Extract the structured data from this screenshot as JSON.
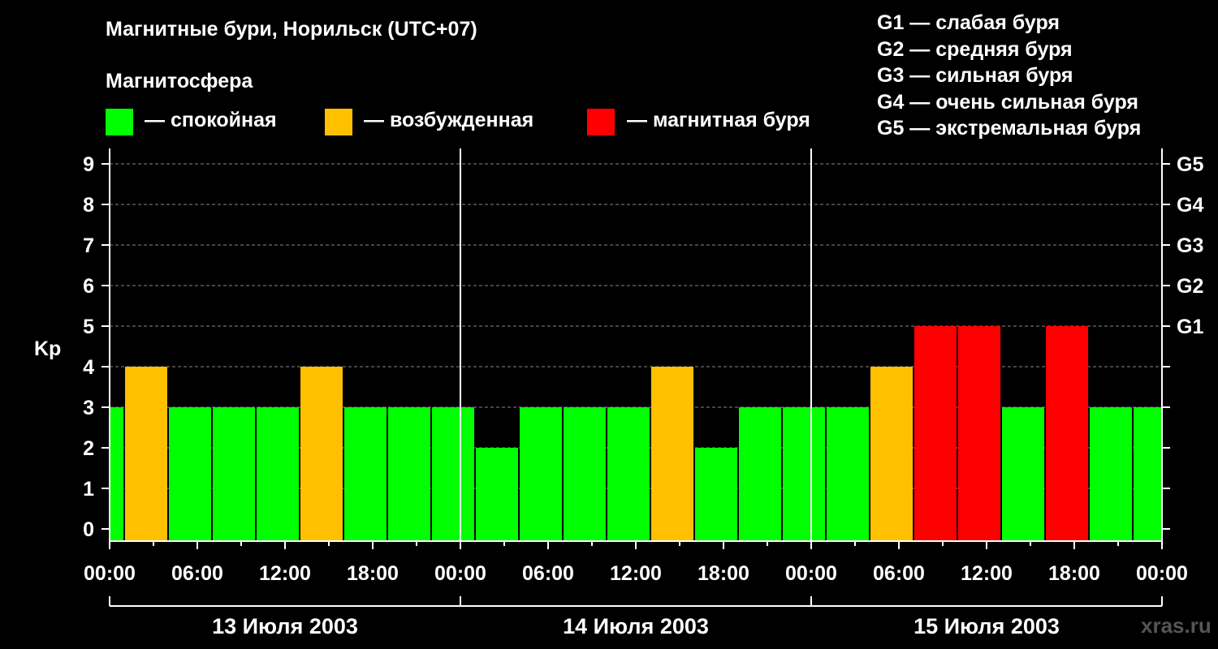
{
  "header": {
    "title": "Магнитные бури, Норильск (UTC+07)",
    "subtitle": "Магнитосфера"
  },
  "legend": [
    {
      "color": "#00ff00",
      "label": "— спокойная"
    },
    {
      "color": "#ffc000",
      "label": "— возбужденная"
    },
    {
      "color": "#ff0000",
      "label": "— магнитная буря"
    }
  ],
  "g_scale": [
    "G1 — слабая буря",
    "G2 — средняя буря",
    "G3 — сильная буря",
    "G4 — очень сильная буря",
    "G5 — экстремальная буря"
  ],
  "watermark": "xras.ru",
  "chart_data": {
    "type": "bar",
    "title": "Магнитные бури, Норильск (UTC+07)",
    "ylabel": "Kp",
    "ylim": [
      0,
      9
    ],
    "yticks": [
      "0",
      "1",
      "2",
      "3",
      "4",
      "5",
      "6",
      "7",
      "8",
      "9"
    ],
    "right_axis_labels": [
      {
        "kp": 5,
        "label": "G1"
      },
      {
        "kp": 6,
        "label": "G2"
      },
      {
        "kp": 7,
        "label": "G3"
      },
      {
        "kp": 8,
        "label": "G4"
      },
      {
        "kp": 9,
        "label": "G5"
      }
    ],
    "xlim_hours": [
      0,
      72
    ],
    "xticks": [
      "00:00",
      "06:00",
      "12:00",
      "18:00",
      "00:00",
      "06:00",
      "12:00",
      "18:00",
      "00:00",
      "06:00",
      "12:00",
      "18:00",
      "00:00"
    ],
    "dates": [
      "13 Июля 2003",
      "14 Июля 2003",
      "15 Июля 2003"
    ],
    "grid": "horizontal dashed",
    "colors": {
      "quiet": "#00ff00",
      "active": "#ffc000",
      "storm": "#ff0000"
    },
    "bars": [
      {
        "start_h": 0,
        "end_h": 1,
        "kp": 3,
        "state": "quiet"
      },
      {
        "start_h": 1,
        "end_h": 4,
        "kp": 4,
        "state": "active"
      },
      {
        "start_h": 4,
        "end_h": 7,
        "kp": 3,
        "state": "quiet"
      },
      {
        "start_h": 7,
        "end_h": 10,
        "kp": 3,
        "state": "quiet"
      },
      {
        "start_h": 10,
        "end_h": 13,
        "kp": 3,
        "state": "quiet"
      },
      {
        "start_h": 13,
        "end_h": 16,
        "kp": 4,
        "state": "active"
      },
      {
        "start_h": 16,
        "end_h": 19,
        "kp": 3,
        "state": "quiet"
      },
      {
        "start_h": 19,
        "end_h": 22,
        "kp": 3,
        "state": "quiet"
      },
      {
        "start_h": 22,
        "end_h": 25,
        "kp": 3,
        "state": "quiet"
      },
      {
        "start_h": 25,
        "end_h": 28,
        "kp": 2,
        "state": "quiet"
      },
      {
        "start_h": 28,
        "end_h": 31,
        "kp": 3,
        "state": "quiet"
      },
      {
        "start_h": 31,
        "end_h": 34,
        "kp": 3,
        "state": "quiet"
      },
      {
        "start_h": 34,
        "end_h": 37,
        "kp": 3,
        "state": "quiet"
      },
      {
        "start_h": 37,
        "end_h": 40,
        "kp": 4,
        "state": "active"
      },
      {
        "start_h": 40,
        "end_h": 43,
        "kp": 2,
        "state": "quiet"
      },
      {
        "start_h": 43,
        "end_h": 46,
        "kp": 3,
        "state": "quiet"
      },
      {
        "start_h": 46,
        "end_h": 49,
        "kp": 3,
        "state": "quiet"
      },
      {
        "start_h": 49,
        "end_h": 52,
        "kp": 3,
        "state": "quiet"
      },
      {
        "start_h": 52,
        "end_h": 55,
        "kp": 4,
        "state": "active"
      },
      {
        "start_h": 55,
        "end_h": 58,
        "kp": 5,
        "state": "storm"
      },
      {
        "start_h": 58,
        "end_h": 61,
        "kp": 5,
        "state": "storm"
      },
      {
        "start_h": 61,
        "end_h": 64,
        "kp": 3,
        "state": "quiet"
      },
      {
        "start_h": 64,
        "end_h": 67,
        "kp": 5,
        "state": "storm"
      },
      {
        "start_h": 67,
        "end_h": 70,
        "kp": 3,
        "state": "quiet"
      },
      {
        "start_h": 70,
        "end_h": 72,
        "kp": 3,
        "state": "quiet"
      }
    ]
  }
}
